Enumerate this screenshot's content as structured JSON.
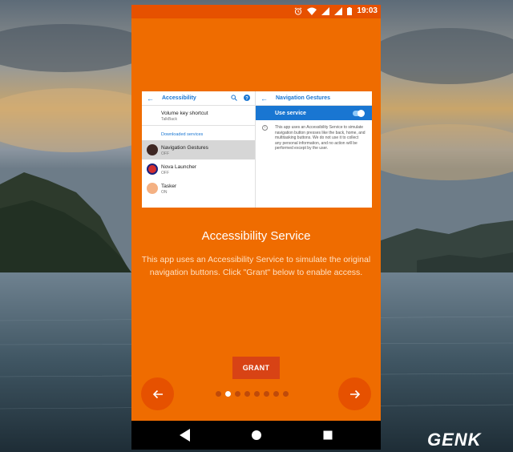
{
  "status_bar": {
    "time": "19:03",
    "icons": [
      "alarm-icon",
      "wifi-icon",
      "signal-icon",
      "signal-icon",
      "battery-icon"
    ]
  },
  "embedded_screenshot": {
    "left_panel": {
      "title": "Accessibility",
      "items": [
        {
          "title": "Volume key shortcut",
          "subtitle": "TalkBack"
        }
      ],
      "section_header": "Downloaded services",
      "services": [
        {
          "title": "Navigation Gestures",
          "subtitle": "OFF",
          "selected": true
        },
        {
          "title": "Nova Launcher",
          "subtitle": "OFF",
          "selected": false
        },
        {
          "title": "Tasker",
          "subtitle": "ON",
          "selected": false
        }
      ]
    },
    "right_panel": {
      "title": "Navigation Gestures",
      "use_service_label": "Use service",
      "description": "This app uses an Accessibility Service to simulate navigation button presses like the back, home, and multitasking buttons. We do not use it to collect any personal information, and no action will be performed except by the user."
    }
  },
  "content": {
    "title": "Accessibility Service",
    "body": "This app uses an Accessibility Service to simulate the original navigation buttons. Click \"Grant\" below to enable access."
  },
  "grant_button": "GRANT",
  "pager": {
    "total": 8,
    "active_index": 1
  },
  "watermark": "GENK",
  "colors": {
    "primary": "#ef6c00",
    "status_bar": "#e65100",
    "grant_button": "#d84315"
  }
}
